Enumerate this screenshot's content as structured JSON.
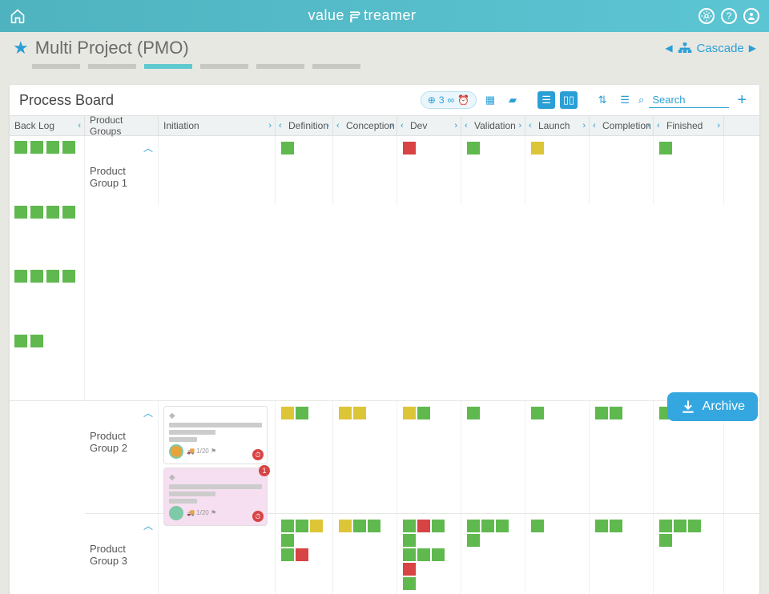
{
  "brand_prefix": "value",
  "brand_suffix": "treamer",
  "page_title": "Multi Project (PMO)",
  "cascade_label": "Cascade",
  "board_title": "Process Board",
  "search_placeholder": "Search",
  "pill_count": "3",
  "archive_label": "Archive",
  "columns": [
    "Back Log",
    "Product Groups",
    "Initiation",
    "Definition",
    "Conception",
    "Dev",
    "Validation",
    "Launch",
    "Completion",
    "Finished"
  ],
  "groups": [
    {
      "name": "Product Group 1"
    },
    {
      "name": "Product Group 2"
    },
    {
      "name": "Product Group 3"
    }
  ],
  "card_meta": "1/20",
  "card_notif": "1",
  "lane1": {
    "c2": [],
    "c3": [
      "g"
    ],
    "c4": [],
    "c5": [
      "r"
    ],
    "c6": [
      "g"
    ],
    "c7": [
      "y"
    ],
    "c8": [],
    "c9": [
      "g"
    ]
  },
  "lane2": {
    "c3": [
      "y",
      "g"
    ],
    "c4": [
      "y",
      "y"
    ],
    "c5": [
      "y",
      "g"
    ],
    "c6": [
      "g"
    ],
    "c7": [
      "g"
    ],
    "c8": [
      "g",
      "g"
    ],
    "c9": [
      "g"
    ]
  },
  "lane3": {
    "c3": [
      [
        "g",
        "g",
        "y",
        "g"
      ],
      [
        "g",
        "r"
      ]
    ],
    "c4": [
      [
        "y",
        "g",
        "g"
      ]
    ],
    "c5": [
      [
        "g",
        "r",
        "g",
        "g"
      ],
      [
        "g",
        "g",
        "g",
        "r"
      ],
      [
        "g"
      ]
    ],
    "c6": [
      [
        "g",
        "g",
        "g"
      ],
      [
        "g"
      ]
    ],
    "c7": [
      [
        "g"
      ]
    ],
    "c8": [
      [
        "g",
        "g"
      ]
    ],
    "c9": [
      [
        "g",
        "g",
        "g"
      ],
      [
        "g"
      ]
    ]
  },
  "backlog_count": 14
}
